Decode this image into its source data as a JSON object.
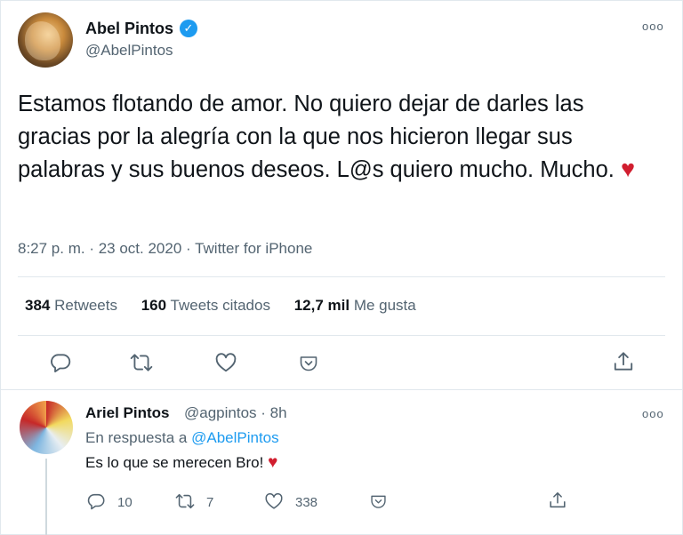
{
  "tweet": {
    "author_name": "Abel Pintos",
    "handle": "@AbelPintos",
    "text": "Estamos flotando de amor. No quiero dejar de darles las gracias por la alegría con la que nos hicieron llegar sus palabras y sus buenos deseos. L@s quiero mucho. Mucho.",
    "emoji": "♥",
    "meta": "8:27 p. m. · 23 oct. 2020 · Twitter for iPhone",
    "stats": {
      "retweets_count": "384",
      "retweets_label": "Retweets",
      "quotes_count": "160",
      "quotes_label": "Tweets citados",
      "likes_count": "12,7 mil",
      "likes_label": "Me gusta"
    },
    "more_label": "ooo",
    "verified_mark": "✓"
  },
  "reply": {
    "author_name": "Ariel Pintos",
    "handle_time": "@agpintos · 8h",
    "replying_prefix": "En respuesta a",
    "replying_to": "@AbelPintos",
    "text": "Es lo que se merecen Bro!",
    "emoji": "♥",
    "reply_count": "10",
    "retweet_count": "7",
    "like_count": "338",
    "more_label": "ooo"
  },
  "icons": {
    "reply": "reply-icon",
    "retweet": "retweet-icon",
    "like": "heart-icon",
    "bookmark": "bookmark-icon",
    "share": "share-icon"
  },
  "colors": {
    "accent": "#1d9bf0",
    "heart": "#d11e2f",
    "secondary_text": "#536471"
  }
}
